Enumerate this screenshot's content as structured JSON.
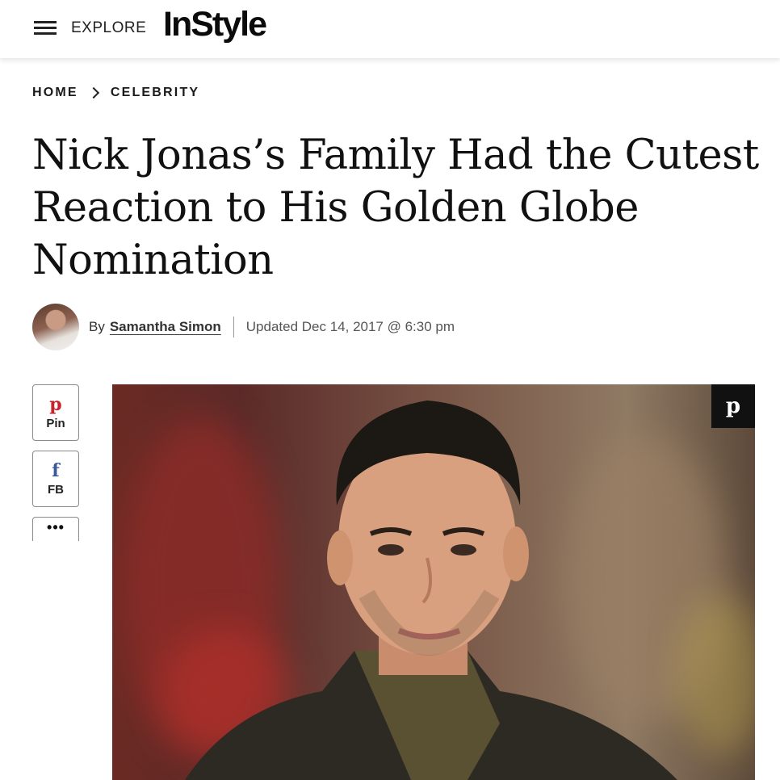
{
  "header": {
    "menu_label": "EXPLORE",
    "logo_text": "InStyle"
  },
  "breadcrumb": {
    "items": [
      "HOME",
      "CELEBRITY"
    ]
  },
  "article": {
    "headline": "Nick Jonas’s Family Had the Cutest Reaction to His Golden Globe Nomination",
    "byline_prefix": "By",
    "author": "Samantha Simon",
    "updated": "Updated Dec 14, 2017 @ 6:30 pm"
  },
  "share": {
    "pin_label": "Pin",
    "fb_label": "FB",
    "pin_glyph": "p",
    "fb_glyph": "f",
    "more_glyph": "•••"
  },
  "hero": {
    "pin_glyph": "p"
  },
  "icons": {
    "menu": "hamburger-icon",
    "pinterest": "pinterest-icon",
    "facebook": "facebook-icon",
    "more": "more-icon"
  },
  "colors": {
    "pinterest": "#c8232c",
    "facebook": "#3b5998",
    "text": "#111111"
  }
}
